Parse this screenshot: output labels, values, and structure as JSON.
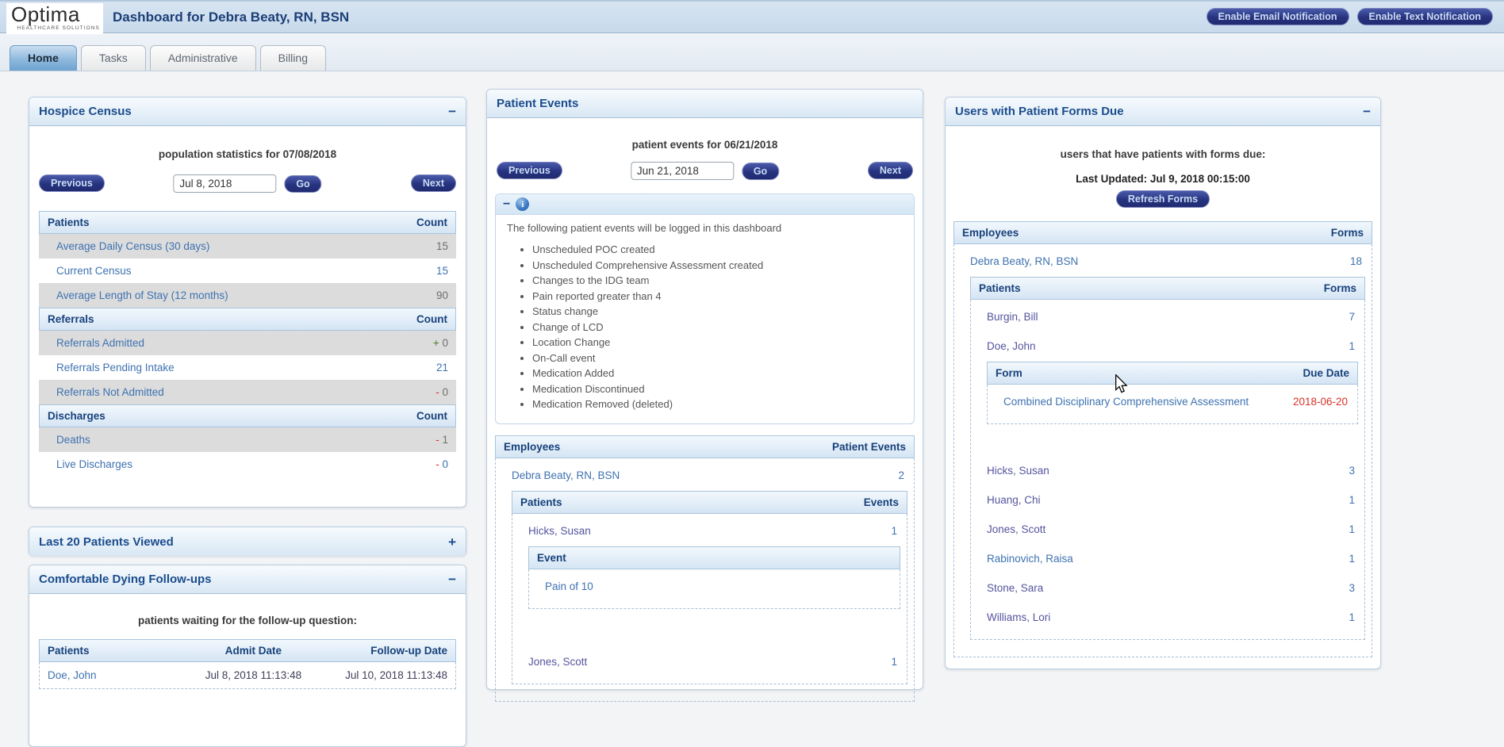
{
  "theme": {
    "header_bg": "#cfe0ee",
    "title_color": "#1c3e77",
    "button_bg": "#27337f",
    "button_text": "#c9ddf4",
    "panel_header_text": "#1b4c8c",
    "link_blue": "#3e72b0",
    "link_purple": "#55549e",
    "value_gray": "#6e6e6e",
    "alert_red": "#d93025",
    "plus_green": "#557b2f",
    "shaded_row": "#dcdcdc",
    "active_tab_bg": "#6da3d1"
  },
  "header": {
    "brand": "Optima",
    "brand_tagline": "HEALTHCARE SOLUTIONS",
    "title": "Dashboard for Debra Beaty, RN, BSN",
    "email_button": "Enable Email Notification",
    "text_button": "Enable Text Notification"
  },
  "tabs": [
    {
      "label": "Home",
      "active": true
    },
    {
      "label": "Tasks",
      "active": false
    },
    {
      "label": "Administrative",
      "active": false
    },
    {
      "label": "Billing",
      "active": false
    }
  ],
  "hospice_census": {
    "title": "Hospice Census",
    "collapse_glyph": "−",
    "subtitle": "population statistics for 07/08/2018",
    "previous_label": "Previous",
    "next_label": "Next",
    "go_label": "Go",
    "date_value": "Jul 8, 2018",
    "sections": [
      {
        "header": "Patients",
        "count_label": "Count",
        "rows": [
          {
            "label": "Average Daily Census (30 days)",
            "value": "15",
            "value_color": "gray",
            "shaded": true
          },
          {
            "label": "Current Census",
            "value": "15",
            "value_color": "blue",
            "shaded": false
          },
          {
            "label": "Average Length of Stay (12 months)",
            "value": "90",
            "value_color": "gray",
            "shaded": true
          }
        ]
      },
      {
        "header": "Referrals",
        "count_label": "Count",
        "rows": [
          {
            "label": "Referrals Admitted",
            "sign": "+",
            "sign_color": "green",
            "value": "0",
            "value_color": "gray",
            "shaded": true
          },
          {
            "label": "Referrals Pending Intake",
            "value": "21",
            "value_color": "blue",
            "shaded": false
          },
          {
            "label": "Referrals Not Admitted",
            "sign": "-",
            "sign_color": "red",
            "value": "0",
            "value_color": "gray",
            "shaded": true
          }
        ]
      },
      {
        "header": "Discharges",
        "count_label": "Count",
        "rows": [
          {
            "label": "Deaths",
            "sign": "-",
            "sign_color": "red",
            "value": "1",
            "value_color": "gray",
            "shaded": true
          },
          {
            "label": "Live Discharges",
            "sign": "-",
            "sign_color": "red",
            "value": "0",
            "value_color": "blue",
            "shaded": false
          }
        ]
      }
    ]
  },
  "last_20_patients": {
    "title": "Last 20 Patients Viewed",
    "collapse_glyph": "+"
  },
  "comfortable_dying": {
    "title": "Comfortable Dying Follow-ups",
    "collapse_glyph": "−",
    "subtitle": "patients waiting for the follow-up question:",
    "columns": [
      "Patients",
      "Admit Date",
      "Follow-up Date"
    ],
    "rows": [
      {
        "patient": "Doe, John",
        "admit": "Jul 8, 2018 11:13:48",
        "followup": "Jul 10, 2018 11:13:48"
      }
    ]
  },
  "patient_events": {
    "title": "Patient Events",
    "subtitle": "patient events for 06/21/2018",
    "previous_label": "Previous",
    "next_label": "Next",
    "go_label": "Go",
    "date_value": "Jun 21, 2018",
    "info": {
      "collapse_glyph": "−",
      "intro": "The following patient events will be logged in this dashboard",
      "bullets": [
        "Unscheduled POC created",
        "Unscheduled Comprehensive Assessment created",
        "Changes to the IDG team",
        "Pain reported greater than 4",
        "Status change",
        "Change of LCD",
        "Location Change",
        "On-Call event",
        "Medication Added",
        "Medication Discontinued",
        "Medication Removed (deleted)"
      ]
    },
    "employees_table": {
      "left": "Employees",
      "right": "Patient Events",
      "rows": [
        {
          "name": "Debra Beaty, RN, BSN",
          "name_color": "blue",
          "value": "2",
          "children": {
            "left": "Patients",
            "right": "Events",
            "rows": [
              {
                "name": "Hicks, Susan",
                "name_color": "purple",
                "value": "1",
                "children": {
                  "left": "Event",
                  "right": "",
                  "rows": [
                    {
                      "name": "Pain of 10",
                      "name_color": "blue",
                      "value": ""
                    }
                  ]
                }
              },
              {
                "name": "Jones, Scott",
                "name_color": "purple",
                "value": "1",
                "spacer": 36
              }
            ]
          }
        }
      ]
    }
  },
  "forms_due": {
    "title": "Users with Patient Forms Due",
    "collapse_glyph": "−",
    "subtitle": "users that have patients with forms due:",
    "last_updated": "Last Updated: Jul 9, 2018 00:15:00",
    "refresh_label": "Refresh Forms",
    "forms_table": {
      "left": "Employees",
      "right": "Forms",
      "rows": [
        {
          "name": "Debra Beaty, RN, BSN",
          "name_color": "blue",
          "value": "18",
          "children": {
            "left": "Patients",
            "right": "Forms",
            "rows": [
              {
                "name": "Burgin, Bill",
                "name_color": "purple",
                "value": "7"
              },
              {
                "name": "Doe, John",
                "name_color": "purple",
                "value": "1",
                "children": {
                  "left": "Form",
                  "right": "Due Date",
                  "rows": [
                    {
                      "name": "Combined Disciplinary Comprehensive Assessment",
                      "name_color": "blue",
                      "value": "2018-06-20",
                      "value_color": "red"
                    }
                  ]
                }
              },
              {
                "name": "Hicks, Susan",
                "name_color": "purple",
                "value": "3",
                "spacer": 28
              },
              {
                "name": "Huang, Chi",
                "name_color": "purple",
                "value": "1"
              },
              {
                "name": "Jones, Scott",
                "name_color": "purple",
                "value": "1"
              },
              {
                "name": "Rabinovich, Raisa",
                "name_color": "blue",
                "value": "1"
              },
              {
                "name": "Stone, Sara",
                "name_color": "purple",
                "value": "3"
              },
              {
                "name": "Williams, Lori",
                "name_color": "purple",
                "value": "1"
              }
            ]
          }
        }
      ]
    }
  }
}
